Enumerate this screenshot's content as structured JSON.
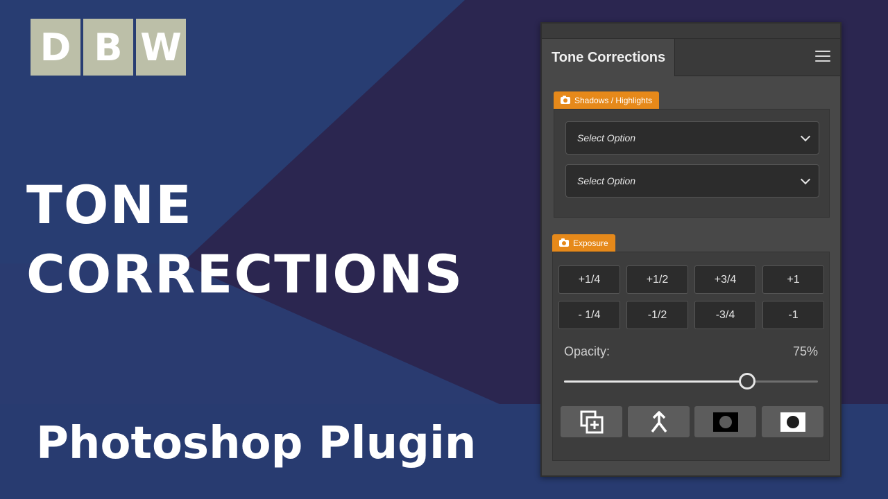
{
  "logo": {
    "letters": [
      "D",
      "B",
      "W"
    ]
  },
  "headline": {
    "line1": "TONE",
    "line2": "CORRECTIONS"
  },
  "subtitle": "Photoshop Plugin",
  "panel": {
    "tab_title": "Tone Corrections",
    "menu_icon": "hamburger-menu-icon",
    "shadows_section": {
      "label": "Shadows / Highlights",
      "icon": "camera-icon",
      "selects": [
        {
          "value": "Select Option"
        },
        {
          "value": "Select Option"
        }
      ]
    },
    "exposure_section": {
      "label": "Exposure",
      "icon": "camera-icon",
      "buttons_row1": [
        "+1/4",
        "+1/2",
        "+3/4",
        "+1"
      ],
      "buttons_row2": [
        "- 1/4",
        "-1/2",
        "-3/4",
        "-1"
      ],
      "opacity_label": "Opacity:",
      "opacity_value": "75%",
      "opacity_level": 0.75,
      "actions": [
        "duplicate-layer-icon",
        "merge-icon",
        "mask-dark-icon",
        "mask-light-icon"
      ]
    }
  },
  "colors": {
    "background_dark": "#2b2650",
    "background_blue": "#283d72",
    "accent_orange": "#e6891a",
    "panel": "#484848"
  }
}
